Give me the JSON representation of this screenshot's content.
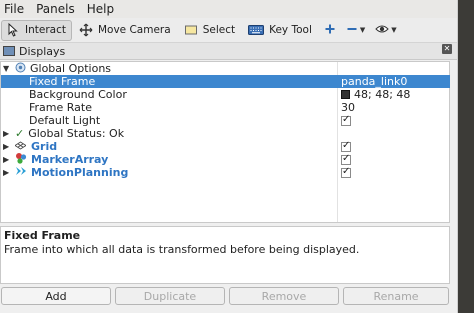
{
  "menubar": {
    "items": [
      "File",
      "Panels",
      "Help"
    ]
  },
  "toolbar": {
    "interact_label": "Interact",
    "move_camera_label": "Move Camera",
    "select_label": "Select",
    "key_tool_label": "Key Tool"
  },
  "panel": {
    "title": "Displays"
  },
  "tree": {
    "global_options": "Global Options",
    "fixed_frame_label": "Fixed Frame",
    "fixed_frame_value": "panda_link0",
    "background_color_label": "Background Color",
    "background_color_value": "48; 48; 48",
    "frame_rate_label": "Frame Rate",
    "frame_rate_value": "30",
    "default_light_label": "Default Light",
    "global_status_label": "Global Status: Ok",
    "grid_label": "Grid",
    "marker_array_label": "MarkerArray",
    "motion_planning_label": "MotionPlanning"
  },
  "description": {
    "title": "Fixed Frame",
    "text": "Frame into which all data is transformed before being displayed."
  },
  "buttons": {
    "add": "Add",
    "duplicate": "Duplicate",
    "remove": "Remove",
    "rename": "Rename"
  },
  "colors": {
    "selection": "#3d87cf",
    "link_blue": "#2e75c3"
  }
}
